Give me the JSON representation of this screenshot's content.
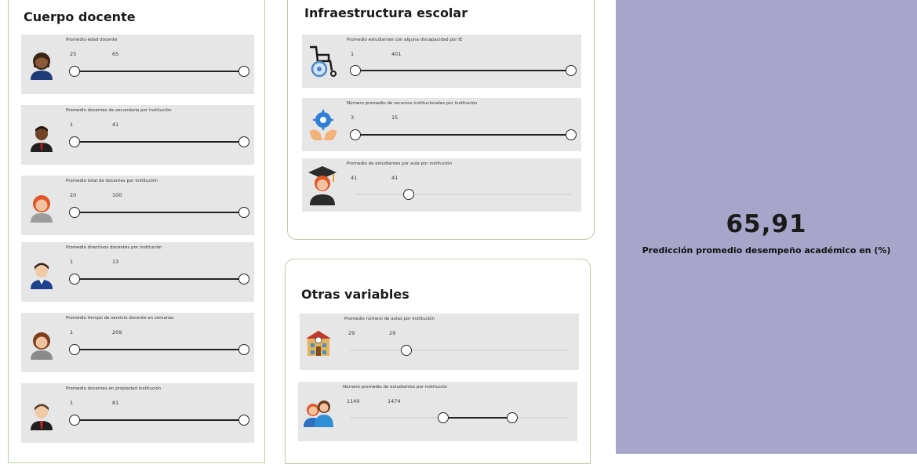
{
  "cuerpo": {
    "title": "Cuerpo docente",
    "sliders": [
      {
        "label": "Promedio edad docente",
        "min": "25",
        "max": "65",
        "icon": "teacher-woman-icon"
      },
      {
        "label": "Promedio docentes de secundaria por institución",
        "min": "1",
        "max": "41",
        "icon": "teacher-man-icon"
      },
      {
        "label": "Promedio total de docentes por institución",
        "min": "20",
        "max": "100",
        "icon": "teacher-redhair-icon"
      },
      {
        "label": "Promedio directivos docentes por institución",
        "min": "1",
        "max": "13",
        "icon": "director-icon"
      },
      {
        "label": "Promedio tiempo de servicio docente en semanas",
        "min": "1",
        "max": "209",
        "icon": "teacher-brown-hair-icon"
      },
      {
        "label": "Promedio docentes en propiedad institución",
        "min": "1",
        "max": "81",
        "icon": "teacher-tie-icon"
      }
    ]
  },
  "infra": {
    "title": "Infraestructura escolar",
    "sliders": [
      {
        "label": "Promedio estudiantes con alguna discapacidad por IE",
        "min": "1",
        "max": "401",
        "icon": "wheelchair-icon"
      },
      {
        "label": "Número promedio de recursos institucionales por institución",
        "min": "3",
        "max": "15",
        "icon": "gear-hands-icon"
      },
      {
        "label": "Promedio de estudiantes por aula por institución",
        "min": "41",
        "max": "41",
        "icon": "graduate-icon"
      }
    ]
  },
  "otras": {
    "title": "Otras variables",
    "sliders": [
      {
        "label": "Promedio número de aulas por institución",
        "min": "29",
        "max": "29",
        "icon": "school-building-icon"
      },
      {
        "label": "Número promedio de estudiantes por institución",
        "min": "1140",
        "max": "1474",
        "icon": "students-icon"
      }
    ]
  },
  "prediction": {
    "value": "65,91",
    "label": "Predicción promedio desempeño académico en (%)"
  },
  "colors": {
    "prediction_bg": "#a7a6ca",
    "card_bg": "#e6e6e6",
    "panel_border": "#b9cfaa"
  }
}
